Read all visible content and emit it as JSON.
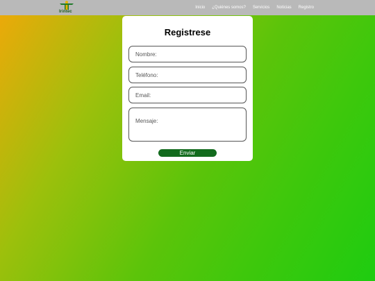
{
  "brand": {
    "logo_text": "Irintec"
  },
  "nav": {
    "items": [
      "Inicio",
      "¿Quiénes somos?",
      "Servicios",
      "Noticias",
      "Registro"
    ]
  },
  "form": {
    "title": "Registrese",
    "nombre_placeholder": "Nombre:",
    "telefono_placeholder": "Teléfono:",
    "email_placeholder": "Email:",
    "mensaje_placeholder": "Mensaje:",
    "submit_label": "Enviar"
  },
  "colors": {
    "navbar": "#b9b9b9",
    "button": "#136b1e",
    "gradient_start": "#f0a80a",
    "gradient_end": "#1ecc10"
  }
}
